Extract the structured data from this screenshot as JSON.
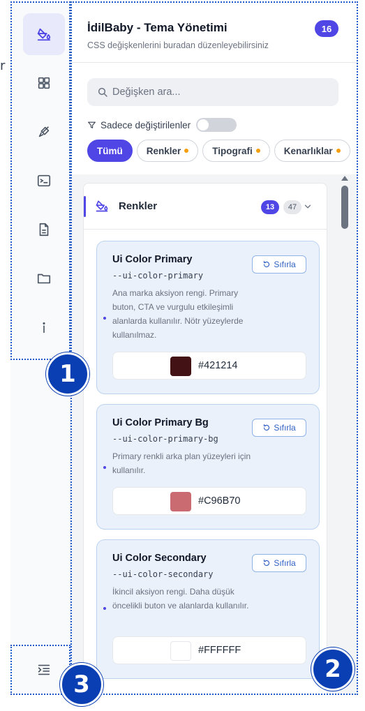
{
  "stray_char": "r",
  "panel": {
    "title": "İdilBaby - Tema Yönetimi",
    "subtitle": "CSS değişkenlerini buradan düzenleyebilirsiniz",
    "count_badge": "16",
    "search_placeholder": "Değişken ara...",
    "filter_label": "Sadece değiştirilenler",
    "chips": [
      {
        "label": "Tümü"
      },
      {
        "label": "Renkler"
      },
      {
        "label": "Tipografi"
      },
      {
        "label": "Kenarlıklar"
      }
    ]
  },
  "group": {
    "title": "Renkler",
    "changed_count": "13",
    "total_count": "47"
  },
  "cards": [
    {
      "title": "Ui Color Primary",
      "var": "--ui-color-primary",
      "desc": "Ana marka aksiyon rengi. Primary buton, CTA ve vurgulu etkileşimli alanlarda kullanılır. Nötr yüzeylerde kullanılmaz.",
      "reset": "Sıfırla",
      "hex": "#421214",
      "swatch": "#421214"
    },
    {
      "title": "Ui Color Primary Bg",
      "var": "--ui-color-primary-bg",
      "desc": "Primary renkli arka plan yüzeyleri için kullanılır.",
      "reset": "Sıfırla",
      "hex": "#C96B70",
      "swatch": "#C96B70"
    },
    {
      "title": "Ui Color Secondary",
      "var": "--ui-color-secondary",
      "desc": "İkincil aksiyon rengi. Daha düşük öncelikli buton ve alanlarda kullanılır.",
      "reset": "Sıfırla",
      "hex": "#FFFFFF",
      "swatch": "#FFFFFF"
    }
  ],
  "callouts": [
    "1",
    "2",
    "3"
  ],
  "colors": {
    "accent": "#4f46e5",
    "annotation": "#0a3fb3",
    "card_bg": "#eaf1fb",
    "card_border": "#bcd3f0"
  },
  "icons": {
    "rail": [
      "paint-bucket-icon",
      "grid-icon",
      "brush-icon",
      "terminal-icon",
      "document-icon",
      "folder-icon",
      "info-icon",
      "indent-icon"
    ]
  }
}
